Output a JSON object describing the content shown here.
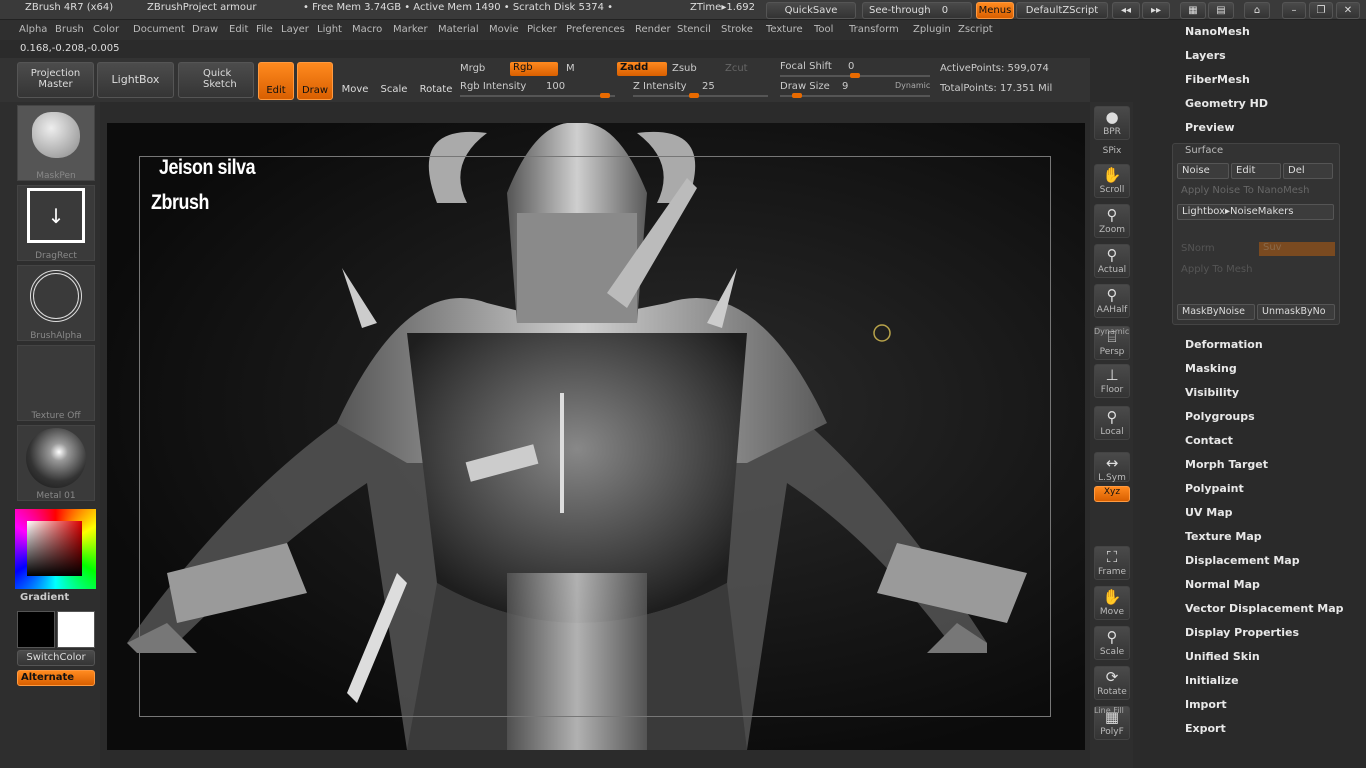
{
  "title": {
    "app": "ZBrush 4R7 (x64)",
    "project": "ZBrushProject armour",
    "status": "• Free Mem 3.74GB • Active Mem 1490 • Scratch Disk 5374 •",
    "ztime": "ZTime▸1.692"
  },
  "titlebuttons": {
    "quicksave": "QuickSave",
    "seethrough": "See-through",
    "seethrough_val": "0",
    "menus": "Menus",
    "defaultscript": "DefaultZScript"
  },
  "menus": [
    "Alpha",
    "Brush",
    "Color",
    "Document",
    "Draw",
    "Edit",
    "File",
    "Layer",
    "Light",
    "Macro",
    "Marker",
    "Material",
    "Movie",
    "Picker",
    "Preferences",
    "Render",
    "Stencil",
    "Stroke",
    "Texture",
    "Tool",
    "Transform",
    "Zplugin",
    "Zscript"
  ],
  "coords": "0.168,-0.208,-0.005",
  "toolbar": {
    "projection": "Projection",
    "master": "Master",
    "lightbox": "LightBox",
    "quick": "Quick",
    "sketch": "Sketch",
    "edit": "Edit",
    "draw": "Draw",
    "move": "Move",
    "scale": "Scale",
    "rotate": "Rotate",
    "mrgb": "Mrgb",
    "rgb": "Rgb",
    "m": "M",
    "zadd": "Zadd",
    "zsub": "Zsub",
    "zcut": "Zcut",
    "rgb_intensity": "Rgb Intensity",
    "rgb_intensity_val": "100",
    "z_intensity": "Z Intensity",
    "z_intensity_val": "25",
    "focal_shift": "Focal Shift",
    "focal_shift_val": "0",
    "draw_size": "Draw Size",
    "draw_size_val": "9",
    "dynamic": "Dynamic",
    "active_points": "ActivePoints: 599,074",
    "total_points": "TotalPoints: 17.351 Mil"
  },
  "shelf": {
    "brush": "MaskPen",
    "stroke": "DragRect",
    "alpha": "BrushAlpha",
    "texture": "Texture Off",
    "material": "Metal 01",
    "gradient": "Gradient",
    "switchcolor": "SwitchColor",
    "alternate": "Alternate"
  },
  "viewport": {
    "caption1": "Jeison silva",
    "caption2": "Zbrush"
  },
  "rightshelf": [
    "BPR",
    "SPix",
    "Scroll",
    "Zoom",
    "Actual",
    "AAHalf",
    "Persp",
    "Floor",
    "Local",
    "L.Sym",
    "Xyz",
    "Frame",
    "Move",
    "Scale",
    "Rotate",
    "PolyF"
  ],
  "rightshelf_extra": {
    "dynamic": "Dynamic",
    "linefill": "Line Fill"
  },
  "panel": {
    "top": [
      "NanoMesh",
      "Layers",
      "FiberMesh",
      "Geometry HD",
      "Preview"
    ],
    "surface": {
      "title": "Surface",
      "noise": "Noise",
      "edit": "Edit",
      "del": "Del",
      "apply_nano": "Apply Noise To NanoMesh",
      "lightbox": "Lightbox▸NoiseMakers",
      "snorm": "SNorm",
      "suv": "Suv",
      "apply_mesh": "Apply To Mesh",
      "mask": "MaskByNoise",
      "unmask": "UnmaskByNo"
    },
    "bottom": [
      "Deformation",
      "Masking",
      "Visibility",
      "Polygroups",
      "Contact",
      "Morph Target",
      "Polypaint",
      "UV Map",
      "Texture Map",
      "Displacement Map",
      "Normal Map",
      "Vector Displacement Map",
      "Display Properties",
      "Unified Skin",
      "Initialize",
      "Import",
      "Export"
    ]
  },
  "colors": {
    "accent": "#e86a00"
  }
}
